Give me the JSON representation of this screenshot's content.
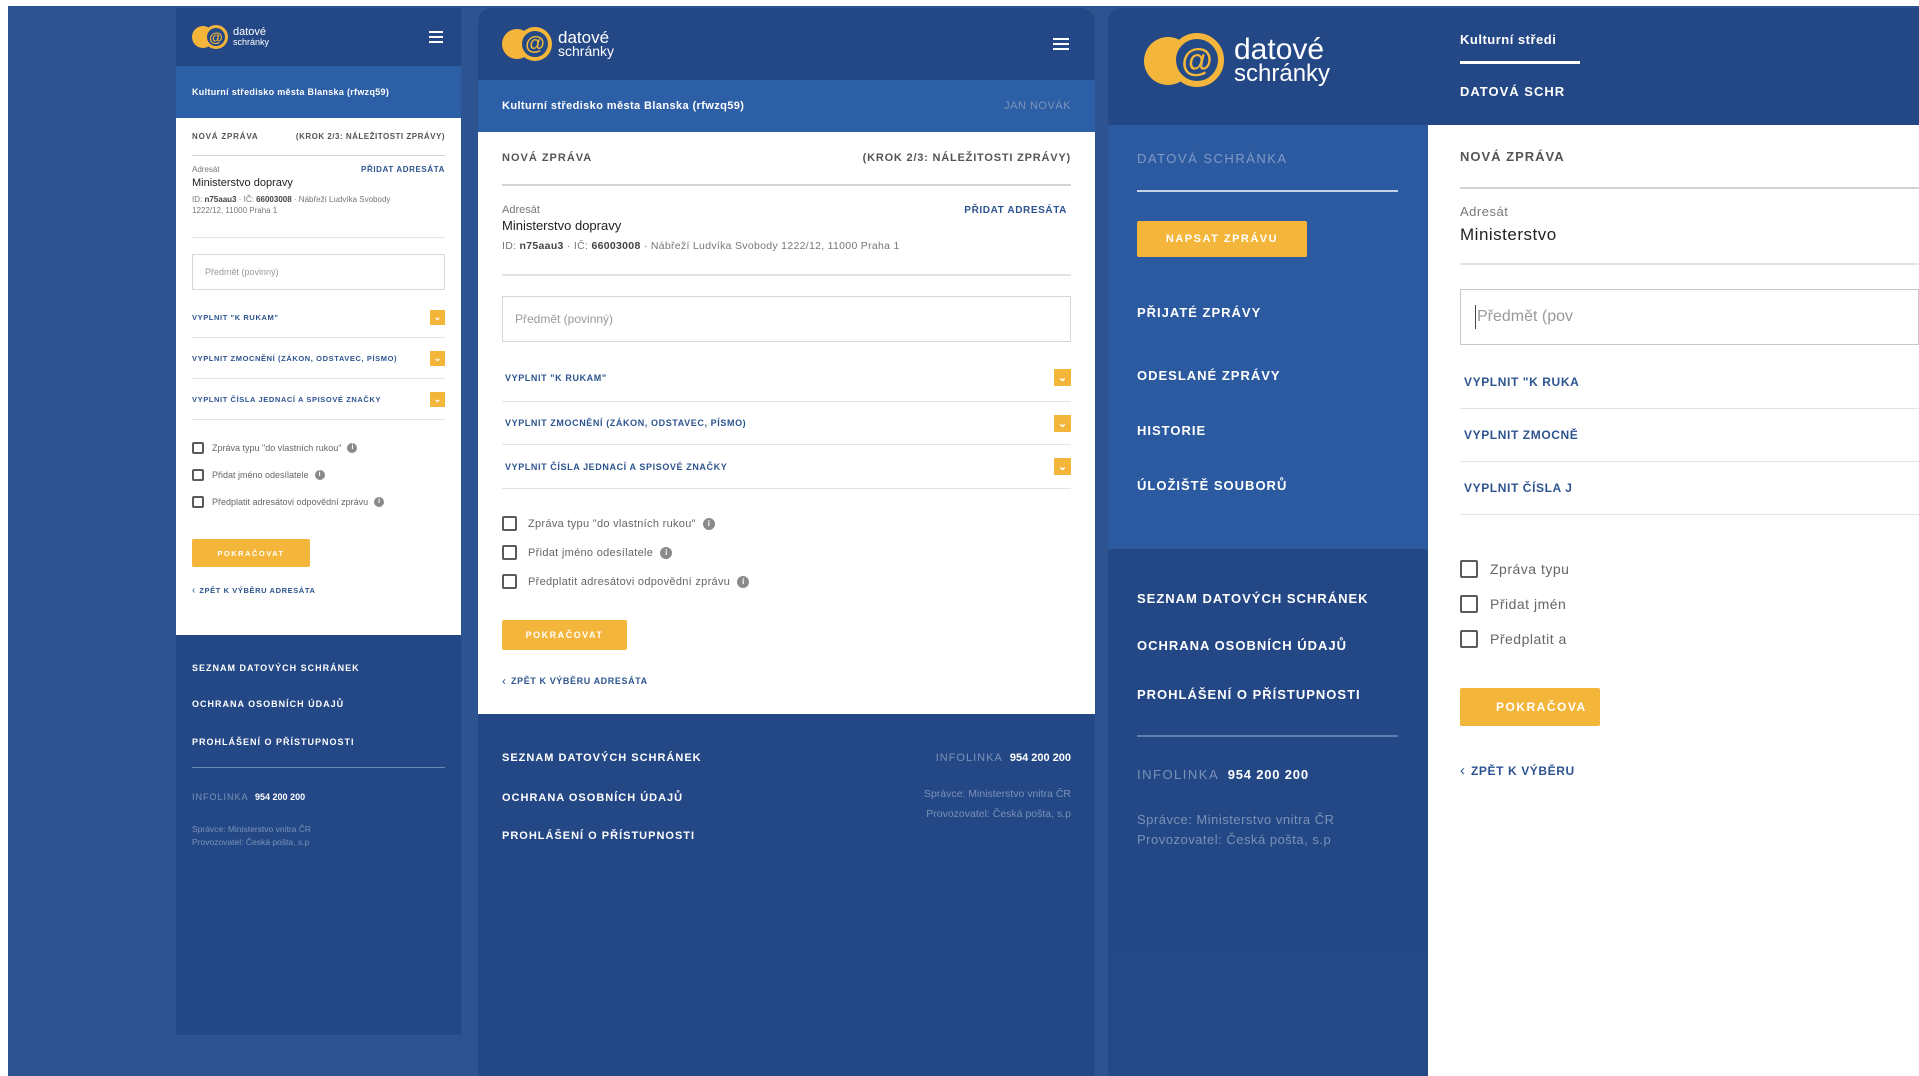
{
  "logo": {
    "line1": "datové",
    "line2": "schránky"
  },
  "org_name": "Kulturní středisko města Blanska (rfwzq59)",
  "org_name_p4": "Kulturní středi",
  "user_name": "JAN NOVÁK",
  "form": {
    "title": "NOVÁ ZPRÁVA",
    "step": "(KROK 2/3: NÁLEŽITOSTI ZPRÁVY)",
    "recipient_label": "Adresát",
    "add_recipient": "PŘIDAT ADRESÁTA",
    "recipient_name": "Ministerstvo dopravy",
    "recipient_name_p4": "Ministerstvo",
    "id_prefix": "ID:",
    "id_value": "n75aau3",
    "ic_prefix": "· IČ:",
    "ic_value": "66003008",
    "address": "· Nábřeží Ludvíka Svobody 1222/12, 11000 Praha 1",
    "address_line_p1a": "· Nábřeží Ludvíka Svobody",
    "address_line_p1b": "1222/12, 11000 Praha 1",
    "subject_placeholder": "Předmět (povinný)",
    "subject_placeholder_p4": "Předmět (pov",
    "expanders": [
      {
        "label": "VYPLNIT \"K RUKAM\"",
        "label_p4": "VYPLNIT \"K RUKA"
      },
      {
        "label": "VYPLNIT ZMOCNĚNÍ (ZÁKON, ODSTAVEC, PÍSMO)",
        "label_p4": "VYPLNIT ZMOCNĚ"
      },
      {
        "label": "VYPLNIT ČÍSLA JEDNACÍ A SPISOVÉ ZNAČKY",
        "label_p4": "VYPLNIT ČÍSLA J"
      }
    ],
    "checkboxes": [
      {
        "label": "Zpráva typu \"do vlastních rukou\"",
        "label_p4": "Zpráva typu"
      },
      {
        "label": "Přidat jméno odesílatele",
        "label_p4": "Přidat jmén"
      },
      {
        "label": "Předplatit adresátovi odpovědní zprávu",
        "label_p4": "Předplatit a"
      }
    ],
    "continue": "POKRAČOVAT",
    "continue_p4": "POKRAČOVA",
    "back": "ZPĚT K VÝBĚRU ADRESÁTA",
    "back_p4": "ZPĚT K VÝBĚRU"
  },
  "footer": {
    "links": [
      "SEZNAM DATOVÝCH SCHRÁNEK",
      "OCHRANA OSOBNÍCH ÚDAJŮ",
      "PROHLÁŠENÍ O PŘÍSTUPNOSTI"
    ],
    "infoline_label": "INFOLINKA",
    "infoline_number": "954 200 200",
    "admin": "Správce: Ministerstvo vnitra ČR",
    "operator": "Provozovatel: Česká pošta, s.p"
  },
  "sidebar": {
    "section": "DATOVÁ SCHRÁNKA",
    "compose": "NAPSAT ZPRÁVU",
    "nav": [
      "PŘIJATÉ ZPRÁVY",
      "ODESLANÉ ZPRÁVY",
      "HISTORIE",
      "ÚLOŽIŠTĚ SOUBORŮ"
    ]
  },
  "p4_tab": "DATOVÁ SCHR",
  "colors": {
    "primary": "#244886",
    "accent": "#f4b63a",
    "link": "#2d5490"
  }
}
